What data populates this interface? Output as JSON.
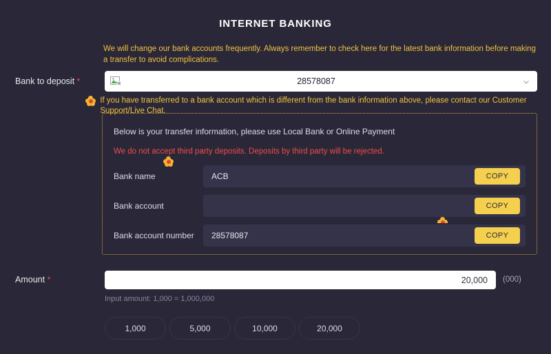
{
  "page": {
    "title": "INTERNET BANKING",
    "background_color": "#2a2838",
    "accent_gold": "#f5d04e",
    "warning_color": "#f0c040",
    "error_color": "#ef4b4b"
  },
  "top_warning": "We will change our bank accounts frequently. Always remember to check here for the latest bank information before making a transfer to avoid complications.",
  "bank_to_deposit": {
    "label": "Bank to deposit",
    "required_mark": "*",
    "selected_value": "28578087",
    "icon": "broken-image-icon",
    "chevron": "chevron-down-icon"
  },
  "second_warning": {
    "icon": "flower-icon",
    "text": "If you have transferred to a bank account which is different from the bank information above, please contact our Customer Support/Live Chat."
  },
  "transfer_panel": {
    "intro": "Below is your transfer information, please use Local Bank or Online Payment",
    "alert": "We do not accept third party deposits. Deposits by third party will be rejected.",
    "rows": [
      {
        "label": "Bank name",
        "value": "ACB",
        "copy_label": "COPY"
      },
      {
        "label": "Bank account",
        "value": "",
        "copy_label": "COPY"
      },
      {
        "label": "Bank account number",
        "value": "28578087",
        "copy_label": "COPY"
      }
    ]
  },
  "amount": {
    "label": "Amount",
    "required_mark": "*",
    "value": "20,000",
    "placeholder": "",
    "suffix": "(000)",
    "hint": "Input amount: 1,000 = 1,000,000",
    "quick_options": [
      "1,000",
      "5,000",
      "10,000",
      "20,000"
    ]
  }
}
